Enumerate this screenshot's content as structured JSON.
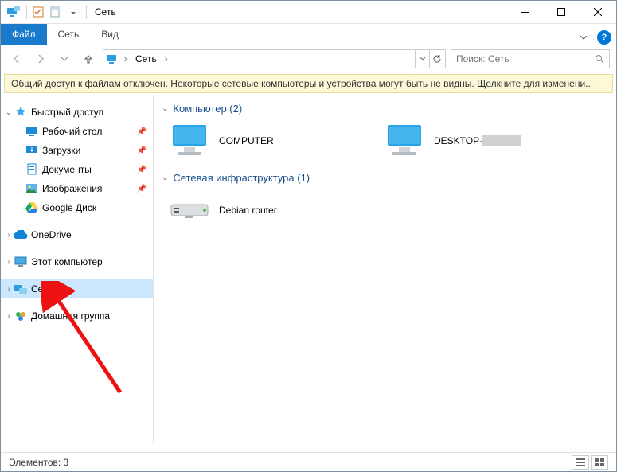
{
  "title": "Сеть",
  "ribbon": {
    "file": "Файл",
    "network": "Сеть",
    "view": "Вид"
  },
  "breadcrumb": {
    "root": "Сеть"
  },
  "search": {
    "placeholder": "Поиск: Сеть"
  },
  "infobar": "Общий доступ к файлам отключен. Некоторые сетевые компьютеры и устройства могут быть не видны. Щелкните для изменени...",
  "sidebar": {
    "quick": "Быстрый доступ",
    "items": [
      "Рабочий стол",
      "Загрузки",
      "Документы",
      "Изображения",
      "Google Диск"
    ],
    "onedrive": "OneDrive",
    "thispc": "Этот компьютер",
    "network": "Сеть",
    "homegroup": "Домашняя группа"
  },
  "groups": {
    "computers": {
      "label": "Компьютер (2)",
      "items": [
        "COMPUTER",
        "DESKTOP-"
      ]
    },
    "infra": {
      "label": "Сетевая инфраструктура (1)",
      "items": [
        "Debian router"
      ]
    }
  },
  "status": "Элементов: 3"
}
